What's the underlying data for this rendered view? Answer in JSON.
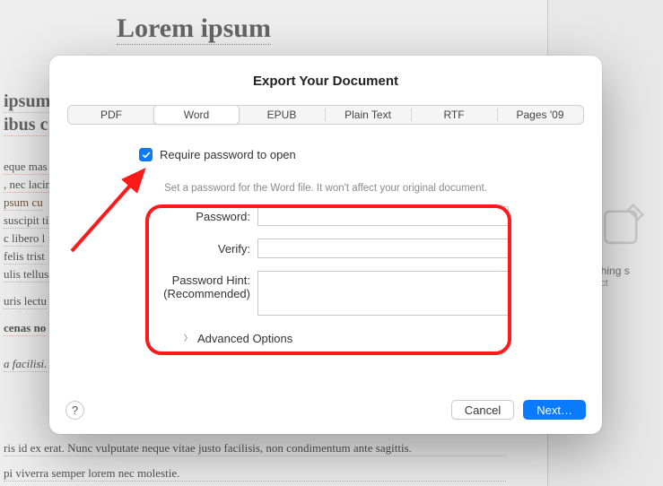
{
  "background": {
    "title": "Lorem ipsum",
    "lines": [
      "ipsum",
      "ibus c",
      "eque mas",
      ", nec lacin",
      "psum cu",
      "suscipit ti",
      "c libero l",
      "felis trist",
      "ulis tellus",
      "uris lectu",
      "cenas no",
      "a facilisi.",
      "ris id ex erat. Nunc vulputate neque vitae justo facilisis, non condimentum ante sagittis.",
      "pi viverra semper lorem nec molestie."
    ],
    "right_panel": {
      "nothing": "Nothing s",
      "sub": "an object"
    }
  },
  "modal": {
    "title": "Export Your Document",
    "tabs": {
      "pdf": "PDF",
      "word": "Word",
      "epub": "EPUB",
      "plain": "Plain Text",
      "rtf": "RTF",
      "pages09": "Pages '09"
    },
    "require_password_label": "Require password to open",
    "instruction": "Set a password for the Word file. It won't affect your original document.",
    "labels": {
      "password": "Password:",
      "verify": "Verify:",
      "hint_line1": "Password Hint:",
      "hint_line2": "(Recommended)"
    },
    "advanced": "Advanced Options",
    "help": "?",
    "buttons": {
      "cancel": "Cancel",
      "next": "Next…"
    }
  }
}
